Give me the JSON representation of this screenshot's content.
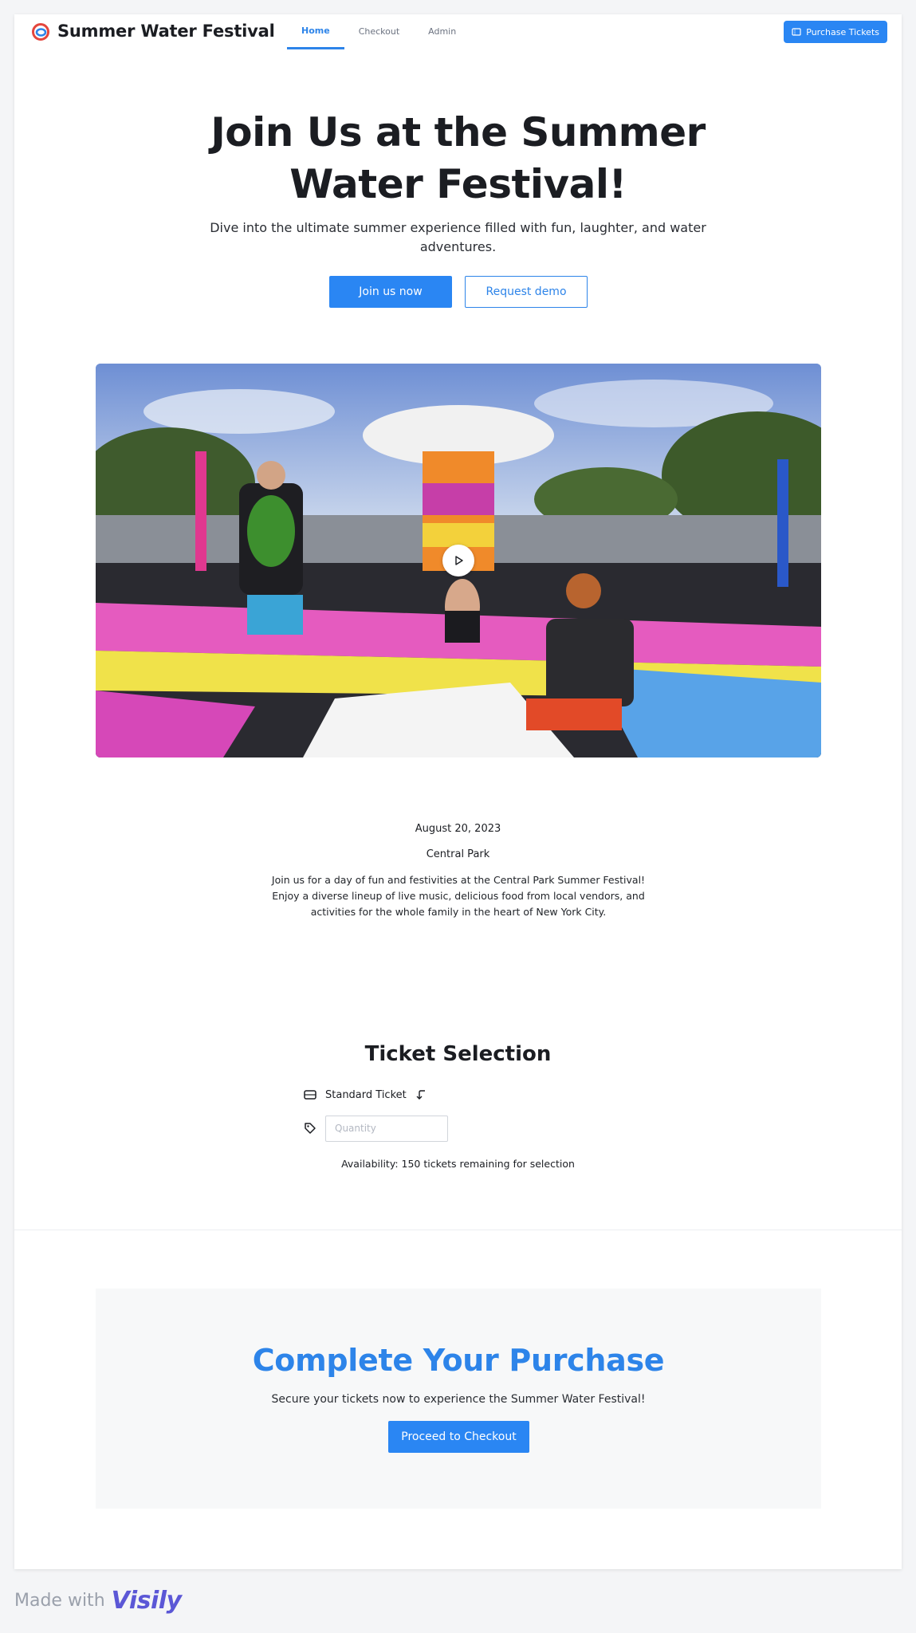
{
  "header": {
    "brand": "Summer Water Festival",
    "nav": [
      {
        "label": "Home",
        "active": true
      },
      {
        "label": "Checkout",
        "active": false
      },
      {
        "label": "Admin",
        "active": false
      }
    ],
    "purchase_button": "Purchase Tickets"
  },
  "hero": {
    "title_line1": "Join Us at the Summer",
    "title_line2": "Water Festival!",
    "subtitle": "Dive into the ultimate summer experience filled with fun, laughter, and water adventures.",
    "primary_button": "Join us now",
    "secondary_button": "Request demo"
  },
  "event": {
    "date": "August 20, 2023",
    "location": "Central Park",
    "description": "Join us for a day of fun and festivities at the Central Park Summer Festival! Enjoy a diverse lineup of live music, delicious food from local vendors, and activities for the whole family in the heart of New York City."
  },
  "tickets": {
    "title": "Ticket Selection",
    "ticket_type": "Standard Ticket",
    "quantity_placeholder": "Quantity",
    "availability": "Availability: 150 tickets remaining for selection"
  },
  "cta": {
    "title": "Complete Your Purchase",
    "subtitle": "Secure your tickets now to experience the Summer Water Festival!",
    "button": "Proceed to Checkout"
  },
  "footer": {
    "made_with": "Made with",
    "logo_text": "Visily"
  },
  "colors": {
    "accent": "#2a86f3",
    "text": "#1b1d22",
    "muted": "#6b7280"
  },
  "icons": [
    "festival-logo-icon",
    "ticket-icon",
    "play-icon",
    "return-arrow-icon",
    "tag-icon"
  ]
}
